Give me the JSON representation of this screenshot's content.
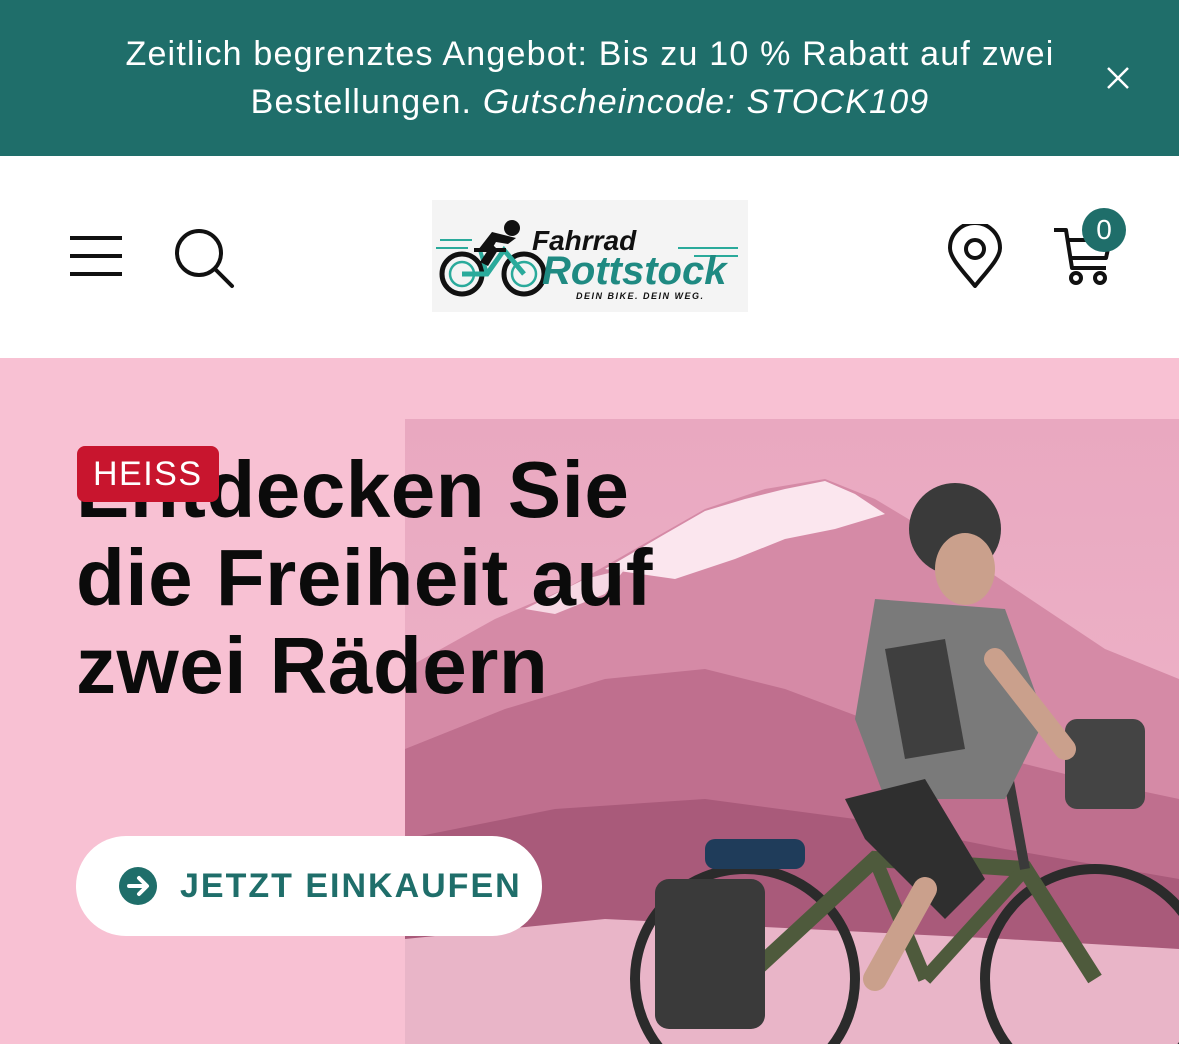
{
  "announcement": {
    "text_line": "Zeitlich begrenztes Angebot: Bis zu 10 % Rabatt auf zwei Bestellungen.",
    "code_text": "Gutscheincode: STOCK109",
    "close_label": "Schließen"
  },
  "header": {
    "logo": {
      "line1": "Fahrrad",
      "line2": "Rottstock",
      "tagline": "DEIN BIKE. DEIN WEG."
    },
    "cart_count": "0"
  },
  "hero": {
    "badge": "HEISS",
    "title": "Entdecken Sie die Freiheit auf zwei Rädern",
    "cta_label": "JETZT EINKAUFEN"
  },
  "colors": {
    "brand_teal": "#1f6e6a",
    "hero_pink": "#f8c1d3",
    "badge_red": "#c8152e"
  },
  "icons": [
    "close-icon",
    "menu-icon",
    "search-icon",
    "location-icon",
    "cart-icon",
    "arrow-right-icon"
  ]
}
